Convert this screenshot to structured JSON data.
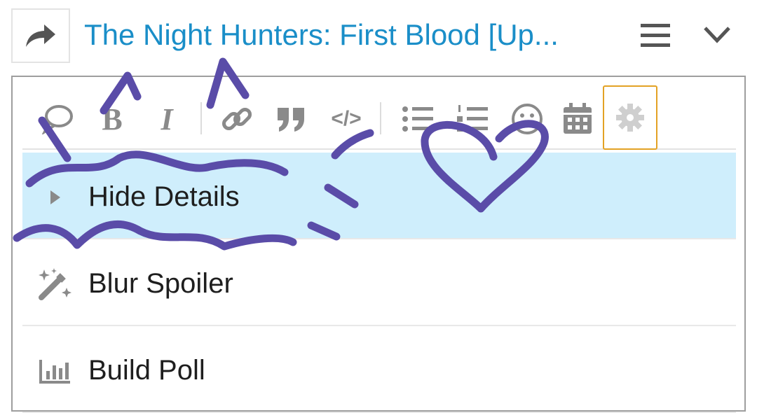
{
  "thread": {
    "title": "The Night Hunters: First Blood [Up..."
  },
  "toolbar": {
    "buttons": [
      {
        "icon": "speech-bubble-icon"
      },
      {
        "icon": "bold-icon",
        "glyph": "B"
      },
      {
        "icon": "italic-icon",
        "glyph": "I"
      },
      {
        "icon": "link-icon"
      },
      {
        "icon": "quote-icon"
      },
      {
        "icon": "code-icon",
        "glyph": "</>"
      },
      {
        "icon": "bulleted-list-icon"
      },
      {
        "icon": "numbered-list-icon"
      },
      {
        "icon": "smiley-icon"
      },
      {
        "icon": "calendar-icon"
      },
      {
        "icon": "gear-icon"
      }
    ]
  },
  "menu": {
    "items": [
      {
        "label": "Hide Details",
        "icon": "triangle-right-icon",
        "active": true
      },
      {
        "label": "Blur Spoiler",
        "icon": "magic-wand-icon",
        "active": false
      },
      {
        "label": "Build Poll",
        "icon": "bar-chart-icon",
        "active": false
      }
    ]
  },
  "colors": {
    "title": "#1a8ec8",
    "icon_gray": "#8a8a8a",
    "active_row": "#cfeefc",
    "settings_border": "#e3a224",
    "scribble": "#5a4ca8"
  }
}
